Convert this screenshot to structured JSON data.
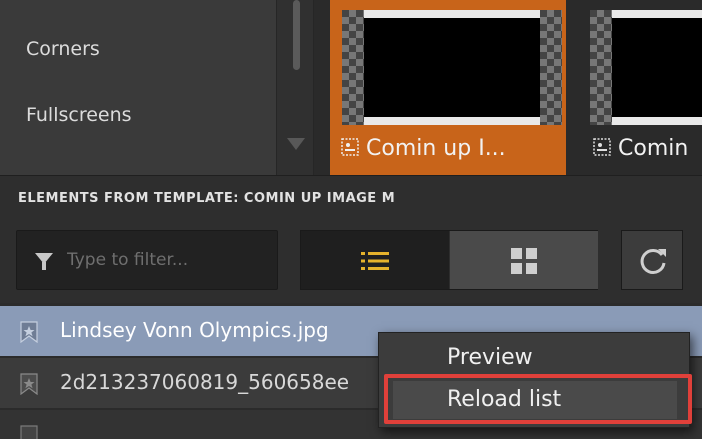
{
  "categories": {
    "items": [
      "Corners",
      "Fullscreens"
    ]
  },
  "templates": [
    {
      "label": "Comin up I...",
      "selected": true
    },
    {
      "label": "Comin",
      "selected": false
    }
  ],
  "elements_header": {
    "title": "ELEMENTS FROM TEMPLATE: COMIN UP IMAGE M"
  },
  "toolbar": {
    "filter_placeholder": "Type to filter...",
    "view_mode": "list"
  },
  "elements": [
    {
      "name": "Lindsey Vonn Olympics.jpg",
      "selected": true
    },
    {
      "name": "2d213237060819_560658ee",
      "selected": false
    }
  ],
  "context_menu": {
    "items": [
      "Preview",
      "Reload list"
    ],
    "highlighted": "Reload list"
  },
  "colors": {
    "accent": "#c8641a",
    "selection": "#8a9bb7",
    "highlight": "#e0403a",
    "list_icon": "#e5b22c"
  }
}
